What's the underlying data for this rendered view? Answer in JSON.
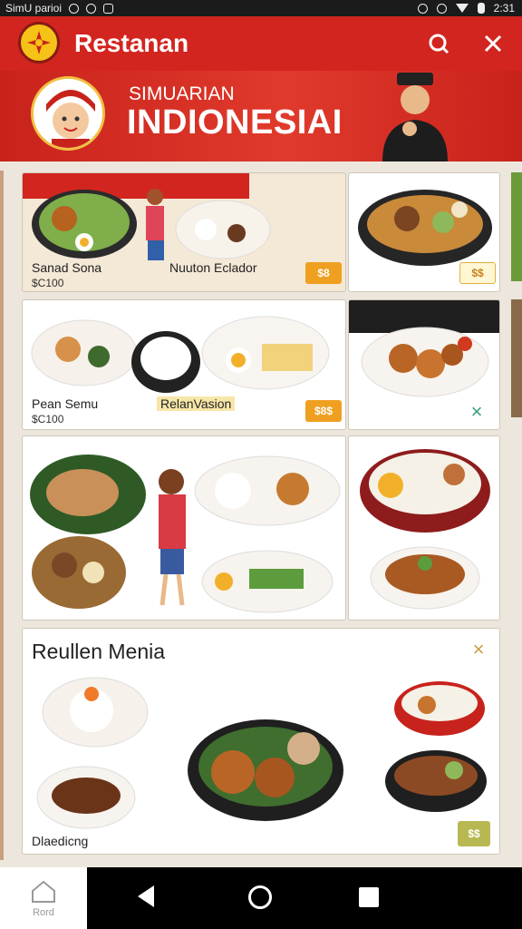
{
  "status_bar": {
    "carrier": "SimU parioi",
    "time": "2:31"
  },
  "app_bar": {
    "title": "Restanan",
    "search_icon": "search-icon",
    "close_icon": "close-icon"
  },
  "hero": {
    "subtitle": "SIMUARIAN",
    "title": "INDIONESIAI"
  },
  "cards": {
    "c1": {
      "label_a": "Sanad Sona",
      "price_a": "$C100",
      "label_b": "Nuuton Eclador",
      "badge": "$8"
    },
    "c2": {
      "badge": "$$"
    },
    "c3": {
      "label_a": "Pean Semu",
      "price_a": "$C100",
      "label_b": "RelanVasion",
      "badge": "$8$"
    },
    "c4": {},
    "menu": {
      "title": "Reullen Menia",
      "footer": "Dlaedicng",
      "badge": "$$"
    }
  },
  "nav": {
    "home_label": "Rord"
  },
  "colors": {
    "brand_red": "#d3251f",
    "accent_orange": "#f0a020",
    "close_green": "#3aa07a"
  }
}
